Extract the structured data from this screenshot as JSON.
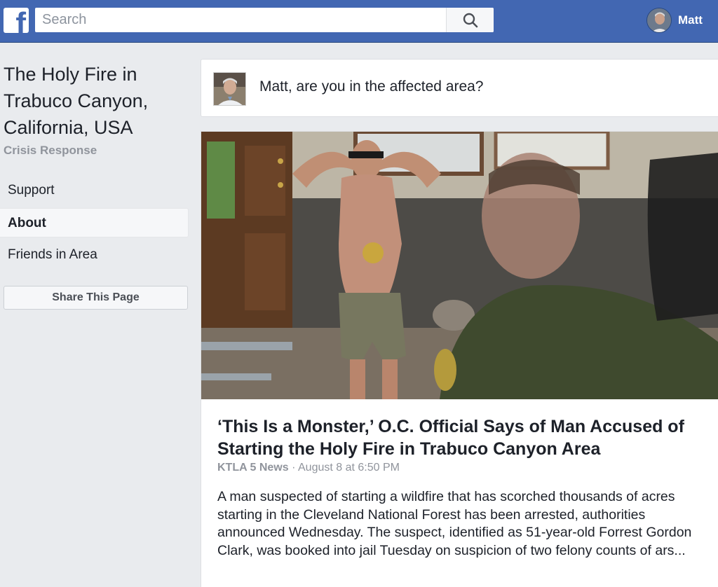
{
  "topbar": {
    "logo_letter": "f",
    "search_placeholder": "Search",
    "user_name": "Matt"
  },
  "page": {
    "title": "The Holy Fire in Trabuco Canyon, California, USA",
    "subtitle": "Crisis Response"
  },
  "nav": {
    "items": [
      {
        "label": "Support",
        "active": false
      },
      {
        "label": "About",
        "active": true
      },
      {
        "label": "Friends in Area",
        "active": false
      }
    ],
    "share_label": "Share This Page"
  },
  "prompt": {
    "question": "Matt, are you in the affected area?"
  },
  "article": {
    "title": "‘This Is a Monster,’ O.C. Official Says of Man Accused of Starting the Holy Fire in Trabuco Canyon Area",
    "source": "KTLA 5 News",
    "separator": " · ",
    "date": "August 8 at 6:50 PM",
    "body": "A man suspected of starting a wildfire that has scorched thousands of acres starting in the Cleveland National Forest has been arrested, authorities announced Wednesday. The suspect, identified as 51-year-old Forrest Gordon Clark, was booked into jail Tuesday on suspicion of two felony counts of ars..."
  },
  "colors": {
    "brand": "#4267b2",
    "background": "#e9ebee",
    "muted_text": "#90949c"
  },
  "icons": {
    "logo": "facebook-logo-icon",
    "search": "search-icon"
  }
}
